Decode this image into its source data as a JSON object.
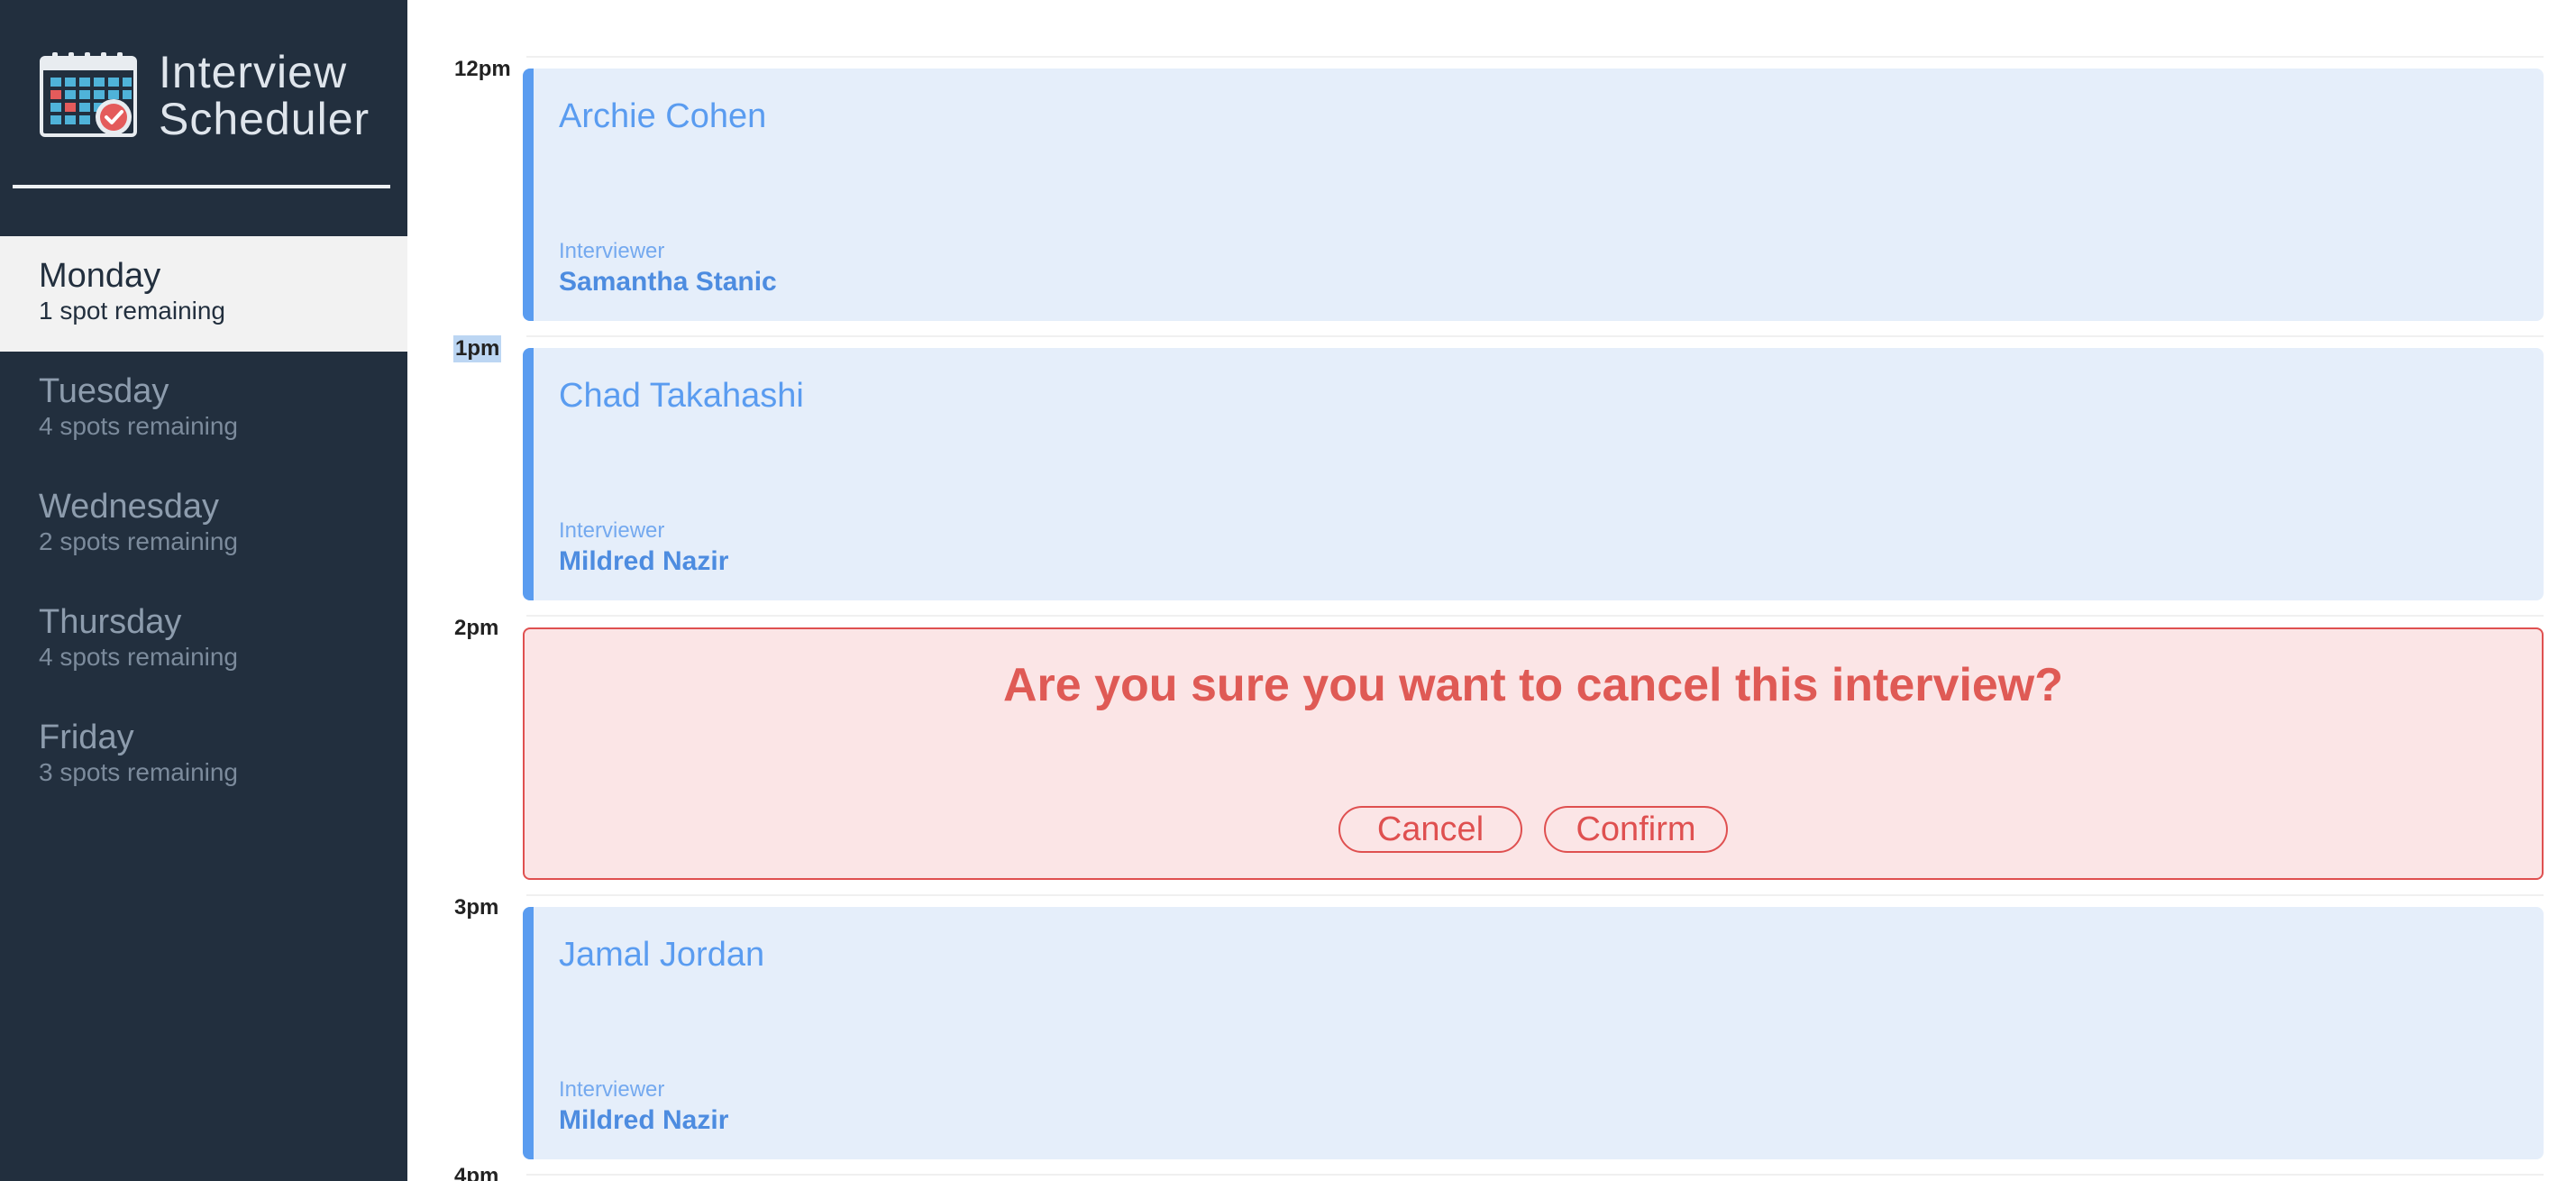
{
  "app": {
    "title_line1": "Interview",
    "title_line2": "Scheduler",
    "logo_icon": "calendar-check-icon"
  },
  "colors": {
    "sidebar": "#222f3e",
    "selected_day_bg": "#f2f2f2",
    "appointment_bg": "#e5eefa",
    "appointment_accent": "#5a9cf0",
    "danger": "#df5050",
    "danger_bg": "#fbe5e6"
  },
  "days": [
    {
      "name": "Monday",
      "spots": "1 spot remaining",
      "selected": true
    },
    {
      "name": "Tuesday",
      "spots": "4 spots remaining",
      "selected": false
    },
    {
      "name": "Wednesday",
      "spots": "2 spots remaining",
      "selected": false
    },
    {
      "name": "Thursday",
      "spots": "4 spots remaining",
      "selected": false
    },
    {
      "name": "Friday",
      "spots": "3 spots remaining",
      "selected": false
    }
  ],
  "schedule": {
    "slots": [
      {
        "time": "12pm",
        "student": "Archie Cohen",
        "interviewer_label": "Interviewer",
        "interviewer": "Samantha Stanic"
      },
      {
        "time": "1pm",
        "student": "Chad Takahashi",
        "interviewer_label": "Interviewer",
        "interviewer": "Mildred Nazir",
        "time_selected": true
      },
      {
        "time": "2pm",
        "confirm": {
          "message": "Are you sure you want to cancel this interview?",
          "cancel_label": "Cancel",
          "confirm_label": "Confirm"
        }
      },
      {
        "time": "3pm",
        "student": "Jamal Jordan",
        "interviewer_label": "Interviewer",
        "interviewer": "Mildred Nazir"
      },
      {
        "time": "4pm"
      }
    ]
  }
}
